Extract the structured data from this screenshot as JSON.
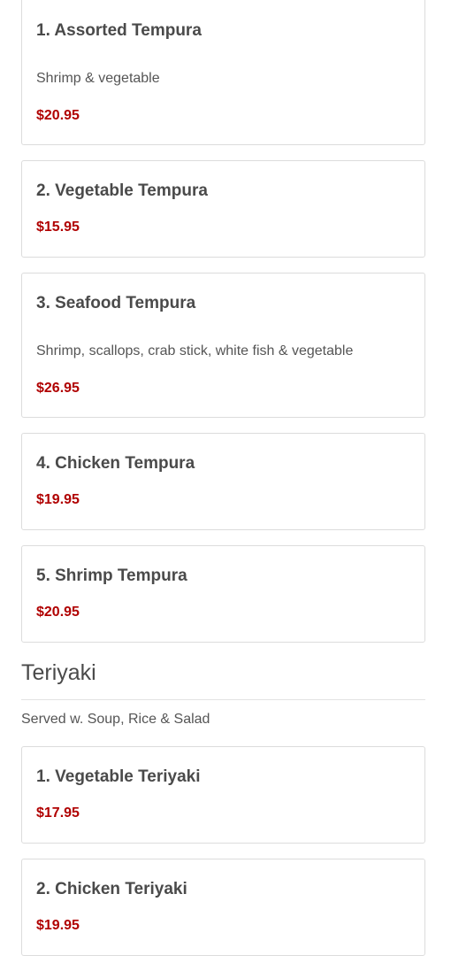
{
  "tempura": {
    "items": [
      {
        "name": "1. Assorted Tempura",
        "description": "Shrimp & vegetable",
        "price": "$20.95"
      },
      {
        "name": "2. Vegetable Tempura",
        "price": "$15.95"
      },
      {
        "name": "3. Seafood Tempura",
        "description": "Shrimp, scallops, crab stick, white fish & vegetable",
        "price": "$26.95"
      },
      {
        "name": "4. Chicken Tempura",
        "price": "$19.95"
      },
      {
        "name": "5. Shrimp Tempura",
        "price": "$20.95"
      }
    ]
  },
  "teriyaki": {
    "title": "Teriyaki",
    "note": "Served w. Soup, Rice & Salad",
    "items": [
      {
        "name": "1. Vegetable Teriyaki",
        "price": "$17.95"
      },
      {
        "name": "2. Chicken Teriyaki",
        "price": "$19.95"
      }
    ]
  },
  "colors": {
    "price": "#b00000",
    "text": "#4a4a4a",
    "border": "#dcdcdc"
  }
}
